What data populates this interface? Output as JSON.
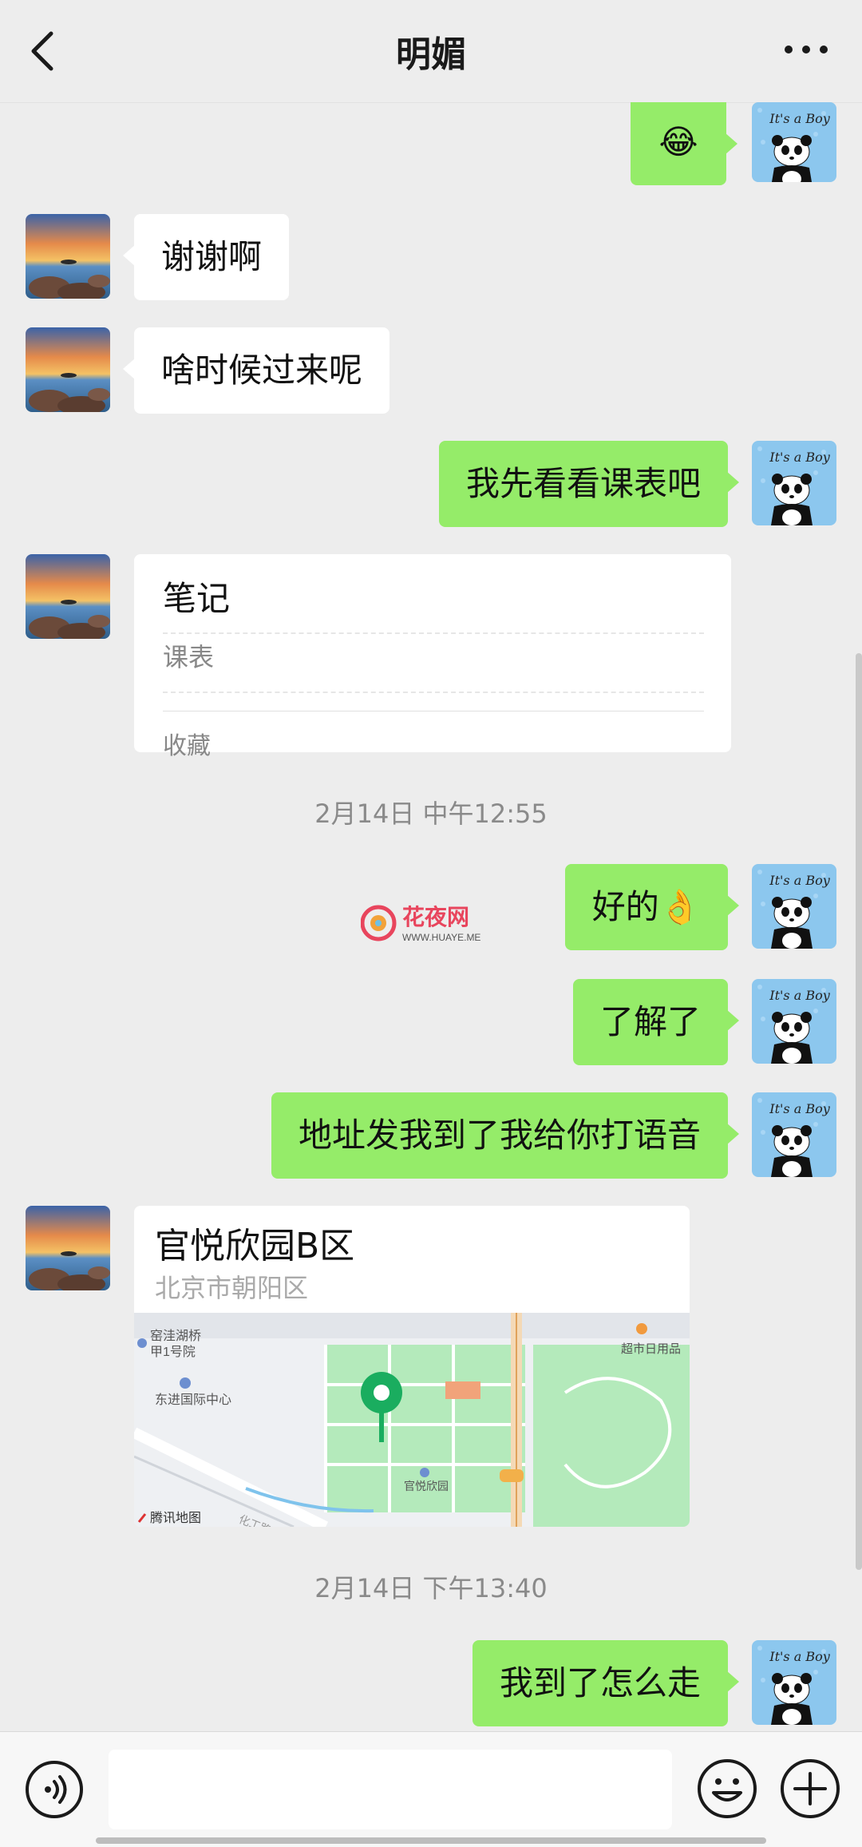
{
  "header": {
    "title": "明媚"
  },
  "messages": [
    {
      "side": "out",
      "emoji": "😂"
    },
    {
      "side": "in",
      "text": "谢谢啊"
    },
    {
      "side": "in",
      "text": "啥时候过来呢"
    },
    {
      "side": "out",
      "text": "我先看看课表吧"
    },
    {
      "side": "in",
      "type": "note",
      "title": "笔记",
      "subtitle": "课表",
      "source": "收藏"
    },
    {
      "type": "timestamp",
      "text": "2月14日 中午12:55"
    },
    {
      "side": "out",
      "text": "好的👌"
    },
    {
      "side": "out",
      "text": "了解了"
    },
    {
      "side": "out",
      "text": "地址发我到了我给你打语音"
    },
    {
      "side": "in",
      "type": "location",
      "name": "官悦欣园B区",
      "address": "北京市朝阳区",
      "map_labels": [
        "窑洼湖桥",
        "甲1号院",
        "东进国际中心",
        "官悦欣园",
        "超市日用品",
        "腾讯地图",
        "化工路"
      ]
    },
    {
      "type": "timestamp",
      "text": "2月14日 下午13:40"
    },
    {
      "side": "out",
      "text": "我到了怎么走"
    }
  ],
  "avatars": {
    "self_text": "It's a Boy"
  },
  "watermark": {
    "brand": "花夜网",
    "url": "WWW.HUAYE.ME"
  },
  "input": {
    "value": ""
  },
  "colors": {
    "outgoing_bubble": "#95ec69",
    "incoming_bubble": "#ffffff",
    "background": "#ededed",
    "map_pin": "#1aad5f"
  },
  "icons": {
    "back": "chevron-left-icon",
    "more": "more-dots-icon",
    "voice": "voice-icon",
    "emoji": "emoji-icon",
    "plus": "plus-icon"
  }
}
